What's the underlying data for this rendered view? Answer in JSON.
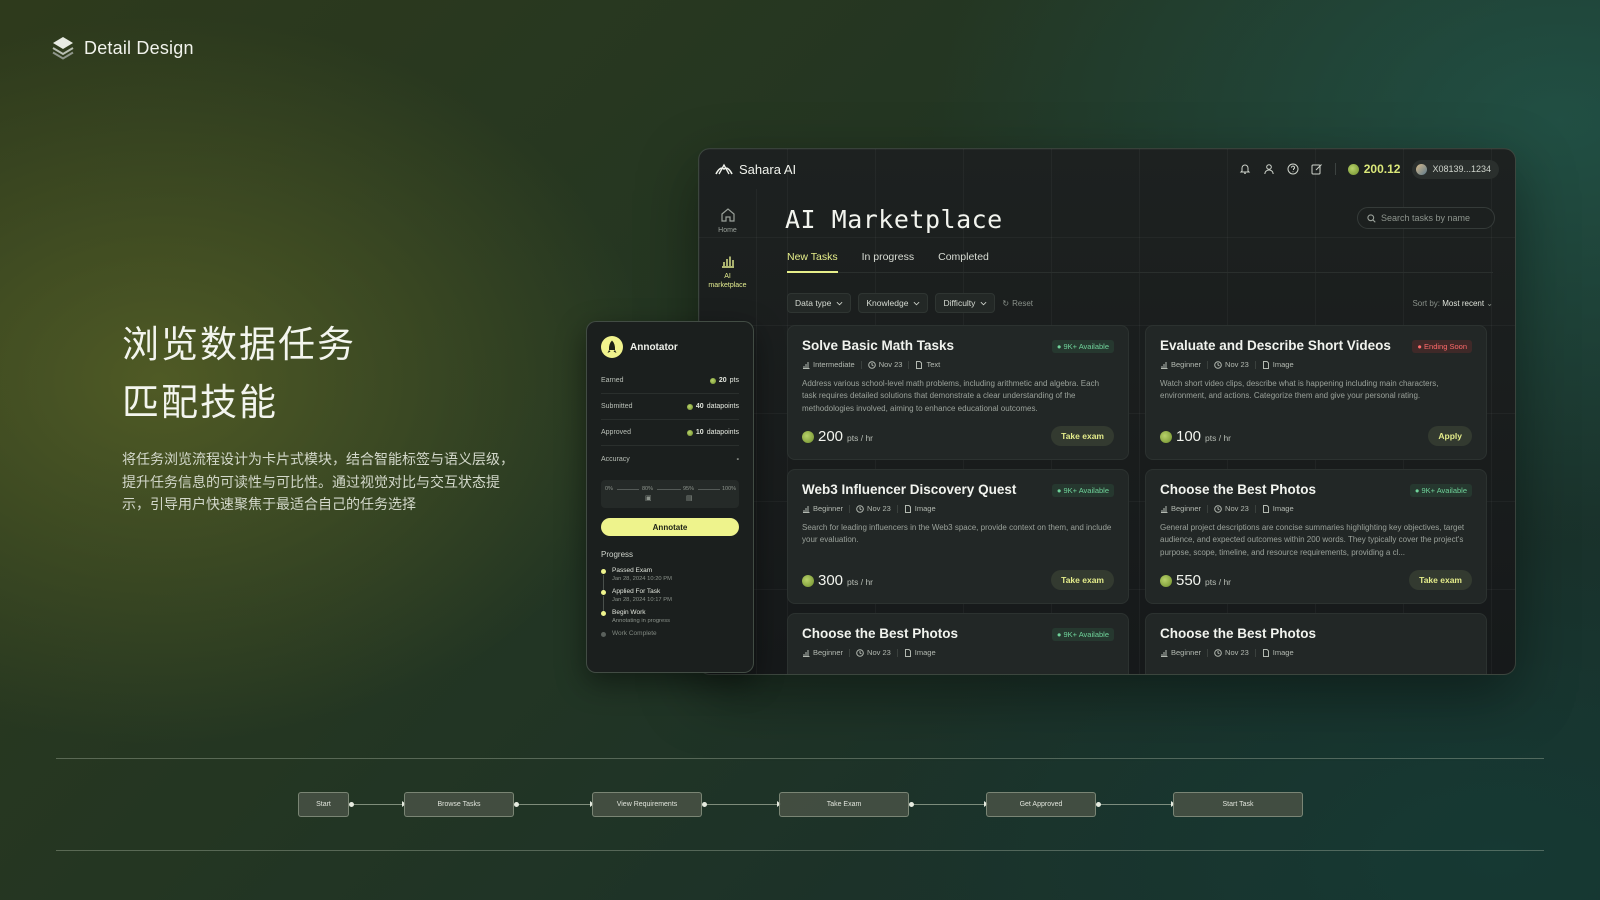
{
  "brand": {
    "title": "Detail Design"
  },
  "hero": {
    "title_line1": "浏览数据任务",
    "title_line2": "匹配技能",
    "description": "将任务浏览流程设计为卡片式模块，结合智能标签与语义层级，提升任务信息的可读性与可比性。通过视觉对比与交互状态提示，引导用户快速聚焦于最适合自己的任务选择"
  },
  "app": {
    "logo": "Sahara AI",
    "balance": "200.12",
    "wallet": "X08139...1234",
    "icons": [
      "bell-icon",
      "user-icon",
      "help-icon",
      "edit-icon"
    ],
    "sidebar": [
      {
        "label": "Home",
        "icon": "home-icon"
      },
      {
        "label": "AI marketplace",
        "icon": "chart-icon"
      }
    ],
    "title": "AI Marketplace",
    "search_placeholder": "Search tasks by name",
    "tabs": [
      "New Tasks",
      "In progress",
      "Completed"
    ],
    "filters": [
      "Data type",
      "Knowledge",
      "Difficulty"
    ],
    "reset": "Reset",
    "sort_label": "Sort by:",
    "sort_value": "Most recent",
    "accent": "#e6ee8a",
    "cards": [
      {
        "title": "Solve Basic Math Tasks",
        "badge": "9K+ Available",
        "level": "Intermediate",
        "date": "Nov 23",
        "type": "Text",
        "desc": "Address various school-level math problems, including arithmetic and algebra. Each task requires detailed solutions that demonstrate a clear understanding of the methodologies involved, aiming to enhance educational outcomes.",
        "points": "200",
        "unit": "pts / hr",
        "action": "Take exam"
      },
      {
        "title": "Evaluate and Describe Short Videos",
        "badge": "Ending Soon",
        "level": "Beginner",
        "date": "Nov 23",
        "type": "Image",
        "desc": "Watch short video clips, describe what is happening including main characters, environment, and actions. Categorize them and give your personal rating.",
        "points": "100",
        "unit": "pts / hr",
        "action": "Apply"
      },
      {
        "title": "Web3 Influencer Discovery Quest",
        "badge": "9K+ Available",
        "level": "Beginner",
        "date": "Nov 23",
        "type": "Image",
        "desc": "Search for leading influencers in the Web3 space, provide context on them, and include your evaluation.",
        "points": "300",
        "unit": "pts / hr",
        "action": "Take exam"
      },
      {
        "title": "Choose the Best Photos",
        "badge": "9K+ Available",
        "level": "Beginner",
        "date": "Nov 23",
        "type": "Image",
        "desc": "General project descriptions are concise summaries highlighting key objectives, target audience, and expected outcomes within 200 words. They typically cover the project's purpose, scope, timeline, and resource requirements, providing a cl...",
        "points": "550",
        "unit": "pts / hr",
        "action": "Take exam"
      },
      {
        "title": "Choose the Best Photos",
        "badge": "9K+ Available",
        "level": "Beginner",
        "date": "Nov 23",
        "type": "Image"
      },
      {
        "title": "Choose the Best Photos",
        "level": "Beginner",
        "date": "Nov 23",
        "type": "Image"
      }
    ]
  },
  "annotator": {
    "name": "Annotator",
    "stats": [
      {
        "label": "Earned",
        "value": "20",
        "unit": "pts"
      },
      {
        "label": "Submitted",
        "value": "40",
        "unit": "datapoints"
      },
      {
        "label": "Approved",
        "value": "10",
        "unit": "datapoints"
      },
      {
        "label": "Accuracy",
        "value": "-",
        "unit": ""
      }
    ],
    "accuracy_ticks": [
      "0%",
      "80%",
      "95%",
      "100%"
    ],
    "button": "Annotate",
    "progress_title": "Progress",
    "steps": [
      {
        "title": "Passed Exam",
        "date": "Jan 28, 2024 10:20 PM",
        "done": true
      },
      {
        "title": "Applied For Task",
        "date": "Jan 28, 2024 10:17 PM",
        "done": true
      },
      {
        "title": "Begin Work",
        "date": "Annotating in progress",
        "done": true
      },
      {
        "title": "Work Complete",
        "date": "",
        "done": false
      }
    ]
  },
  "flow": [
    "Start",
    "Browse Tasks",
    "View Requirements",
    "Take Exam",
    "Get Approved",
    "Start Task"
  ]
}
